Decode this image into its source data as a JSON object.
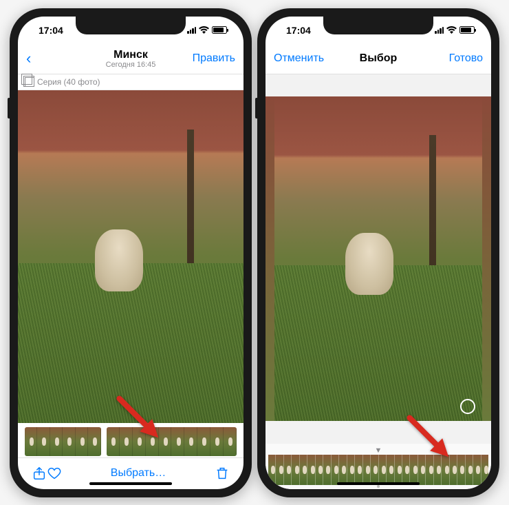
{
  "left_phone": {
    "status": {
      "time": "17:04"
    },
    "nav": {
      "back": "‹",
      "title": "Минск",
      "subtitle": "Сегодня 16:45",
      "right": "Править"
    },
    "burst": {
      "label": "Серия (40 фото)"
    },
    "toolbar": {
      "select_label": "Выбрать…"
    }
  },
  "right_phone": {
    "status": {
      "time": "17:04"
    },
    "nav": {
      "left": "Отменить",
      "title": "Выбор",
      "right": "Готово"
    }
  },
  "colors": {
    "ios_blue": "#007aff",
    "arrow_red": "#d82a1f"
  }
}
